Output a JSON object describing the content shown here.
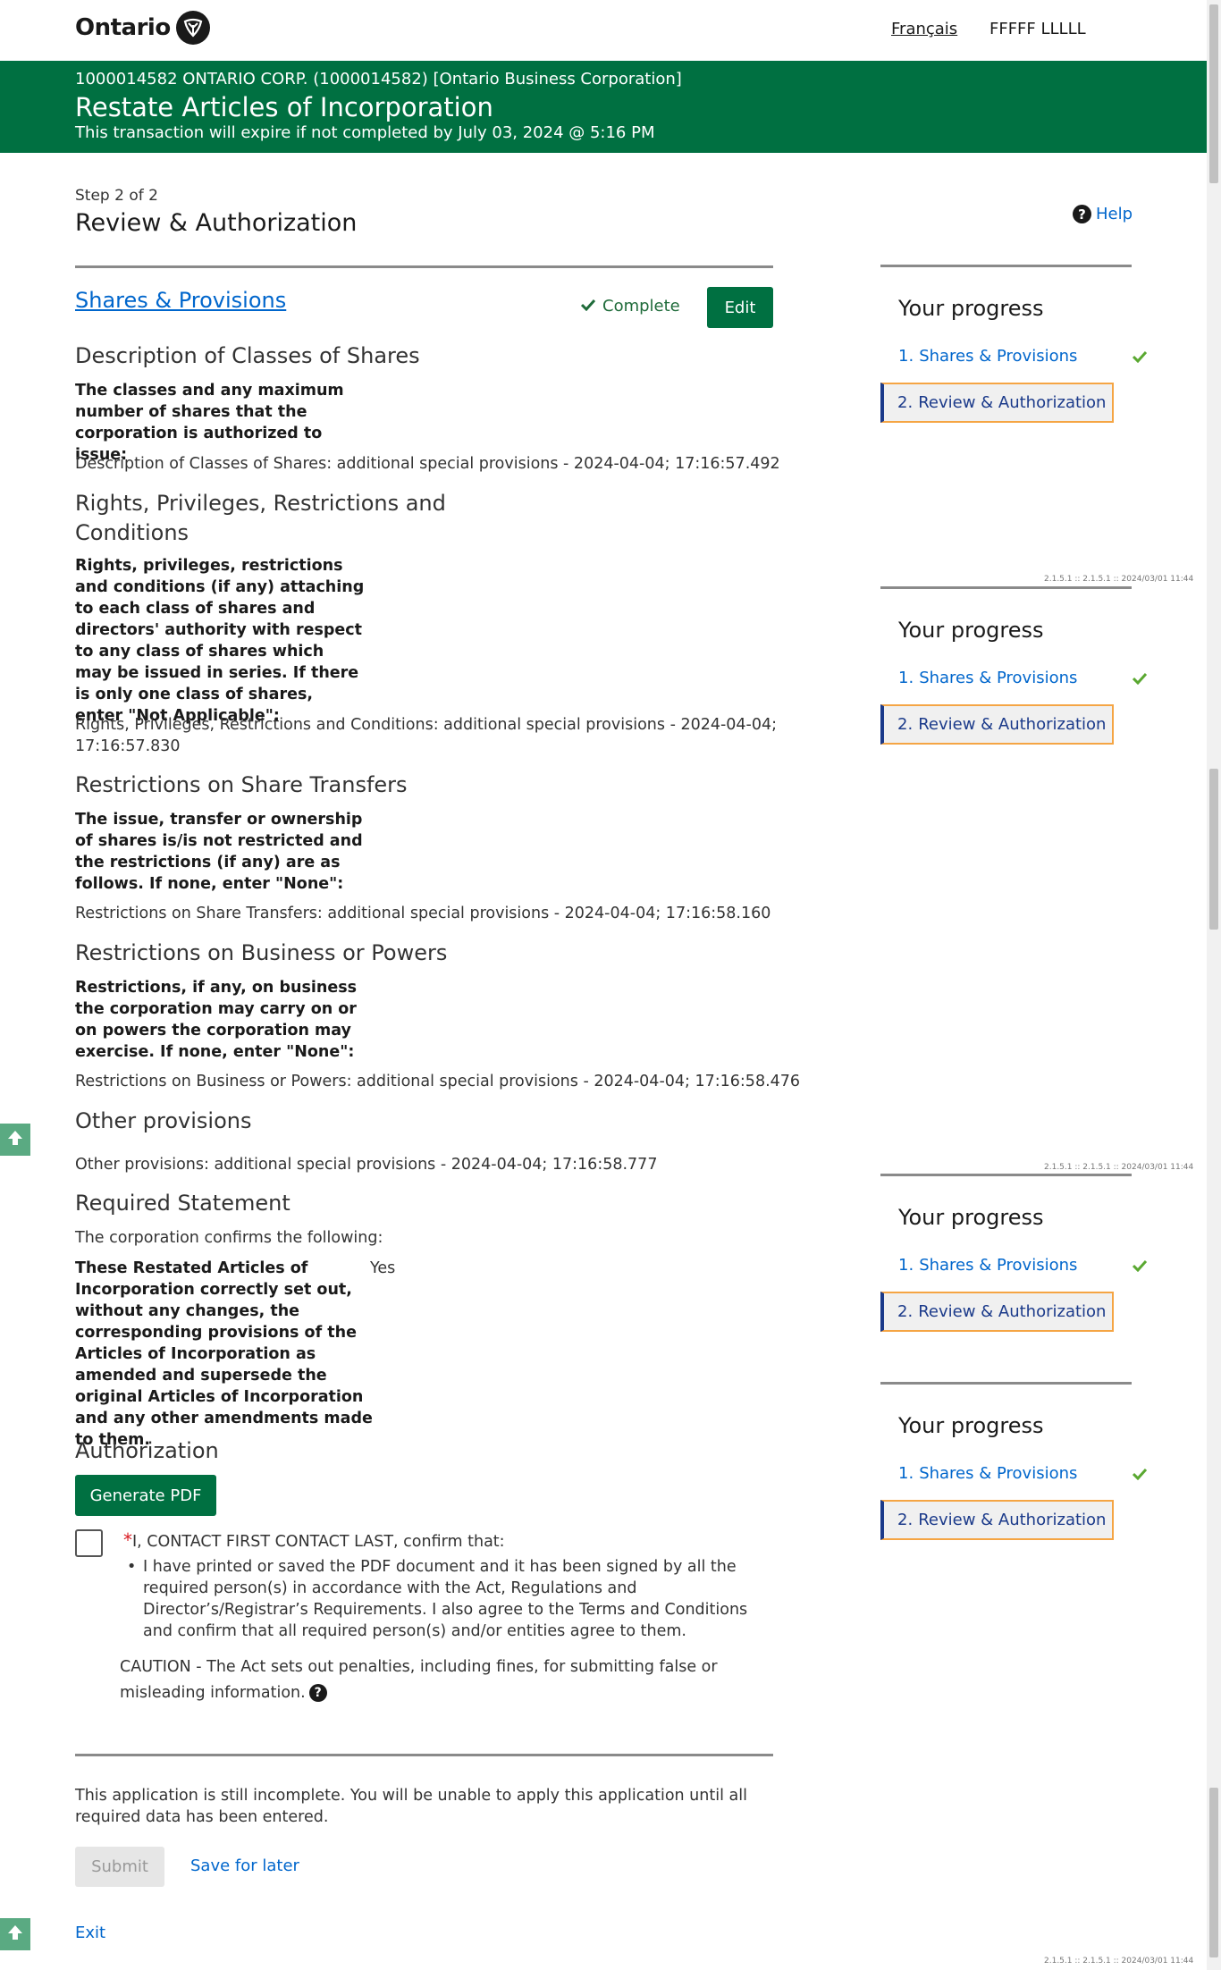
{
  "header": {
    "logo_text": "Ontario",
    "lang_link": "Français",
    "user_name": "FFFFF LLLLL"
  },
  "banner": {
    "corp": "1000014582 ONTARIO CORP. (1000014582) [Ontario Business Corporation]",
    "title": "Restate Articles of Incorporation",
    "expire": "This transaction will expire if not completed by July 03, 2024 @ 5:16 PM"
  },
  "colors": {
    "brand_green": "#007041",
    "link_blue": "#0066cc",
    "focus_orange": "#f5a544",
    "nav_blue": "#1b3a8a",
    "check_green": "#5aa831"
  },
  "step": {
    "label": "Step 2 of 2",
    "title": "Review & Authorization",
    "help": "Help"
  },
  "section": {
    "link": "Shares & Provisions",
    "status": "Complete",
    "edit": "Edit"
  },
  "classes": {
    "heading": "Description of Classes of Shares",
    "question": "The classes and any maximum number of shares that the corporation is authorized to issue:",
    "answer": "Description of Classes of Shares: additional special provisions - 2024-04-04; 17:16:57.492"
  },
  "rights": {
    "heading": "Rights, Privileges, Restrictions and Conditions",
    "question": "Rights, privileges, restrictions and conditions (if any) attaching to each class of shares and directors' authority with respect to any class of shares which may be issued in series. If there is only one class of shares, enter \"Not Applicable\":",
    "answer": "Rights, Privileges, Restrictions and Conditions: additional special provisions - 2024-04-04; 17:16:57.830"
  },
  "transfers": {
    "heading": "Restrictions on Share Transfers",
    "question": "The issue, transfer or ownership of shares is/is not restricted and the restrictions (if any) are as follows. If none, enter \"None\":",
    "answer": "Restrictions on Share Transfers: additional special provisions - 2024-04-04; 17:16:58.160"
  },
  "business": {
    "heading": "Restrictions on Business or Powers",
    "question": "Restrictions, if any, on business the corporation may carry on or on powers the corporation may exercise. If none, enter \"None\":",
    "answer": "Restrictions on Business or Powers: additional special provisions - 2024-04-04; 17:16:58.476"
  },
  "other": {
    "heading": "Other provisions",
    "answer": "Other provisions: additional special provisions - 2024-04-04; 17:16:58.777"
  },
  "required": {
    "heading": "Required Statement",
    "intro": "The corporation confirms the following:",
    "question": "These Restated Articles of Incorporation correctly set out, without any changes, the corresponding provisions of the Articles of Incorporation as amended and supersede the original Articles of Incorporation and any other amendments made to them.",
    "answer": "Yes"
  },
  "authorization": {
    "heading": "Authorization",
    "generate": "Generate PDF",
    "required_mark": "*",
    "confirm": "I, CONTACT FIRST CONTACT LAST, confirm that:",
    "bullet": "I have printed or saved the PDF document and it has been signed by all the required person(s) in accordance with the Act, Regulations and Director’s/Registrar’s Requirements. I also agree to the Terms and Conditions and confirm that all required person(s) and/or entities agree to them.",
    "caution": "CAUTION - The Act sets out penalties, including fines, for submitting false or misleading information."
  },
  "footer": {
    "incomplete": "This application is still incomplete. You will be unable to apply this application until all required data has been entered.",
    "submit": "Submit",
    "save": "Save for later",
    "exit": "Exit"
  },
  "progress": {
    "title": "Your progress",
    "item1_num": "1.",
    "item1": "Shares & Provisions",
    "item2_num": "2.",
    "item2": "Review & Authorization"
  },
  "version": "2.1.5.1 :: 2.1.5.1 :: 2024/03/01 11:44"
}
